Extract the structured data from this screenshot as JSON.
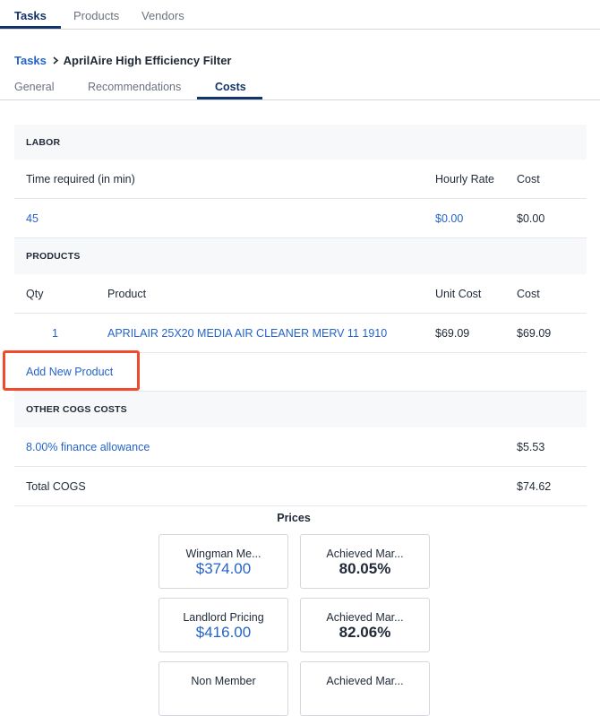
{
  "top_tabs": [
    {
      "label": "Tasks",
      "active": true
    },
    {
      "label": "Products",
      "active": false
    },
    {
      "label": "Vendors",
      "active": false
    }
  ],
  "breadcrumb": {
    "parent": "Tasks",
    "current": "AprilAire High Efficiency Filter"
  },
  "sub_tabs": [
    {
      "label": "General",
      "active": false
    },
    {
      "label": "Recommendations",
      "active": false
    },
    {
      "label": "Costs",
      "active": true
    }
  ],
  "labor": {
    "section_label": "LABOR",
    "headers": {
      "time": "Time required (in min)",
      "rate": "Hourly Rate",
      "cost": "Cost"
    },
    "row": {
      "time": "45",
      "rate": "$0.00",
      "cost": "$0.00"
    }
  },
  "products": {
    "section_label": "PRODUCTS",
    "headers": {
      "qty": "Qty",
      "product": "Product",
      "unit_cost": "Unit Cost",
      "cost": "Cost"
    },
    "rows": [
      {
        "qty": "1",
        "product": "APRILAIR 25X20 MEDIA AIR CLEANER MERV 11 1910",
        "unit_cost": "$69.09",
        "cost": "$69.09"
      }
    ],
    "add_label": "Add New Product"
  },
  "other_cogs": {
    "section_label": "OTHER COGS COSTS",
    "finance": {
      "label": "8.00% finance allowance",
      "value": "$5.53"
    },
    "total": {
      "label": "Total COGS",
      "value": "$74.62"
    }
  },
  "prices": {
    "title": "Prices",
    "cards": [
      {
        "label": "Wingman Me...",
        "value": "$374.00",
        "margin_label": "Achieved Mar...",
        "margin_value": "80.05%"
      },
      {
        "label": "Landlord Pricing",
        "value": "$416.00",
        "margin_label": "Achieved Mar...",
        "margin_value": "82.06%"
      },
      {
        "label": "Non Member",
        "value": "",
        "margin_label": "Achieved Mar...",
        "margin_value": ""
      }
    ]
  },
  "colors": {
    "accent": "#13346b",
    "link": "#2563c9",
    "highlight": "#ef4a2b"
  }
}
